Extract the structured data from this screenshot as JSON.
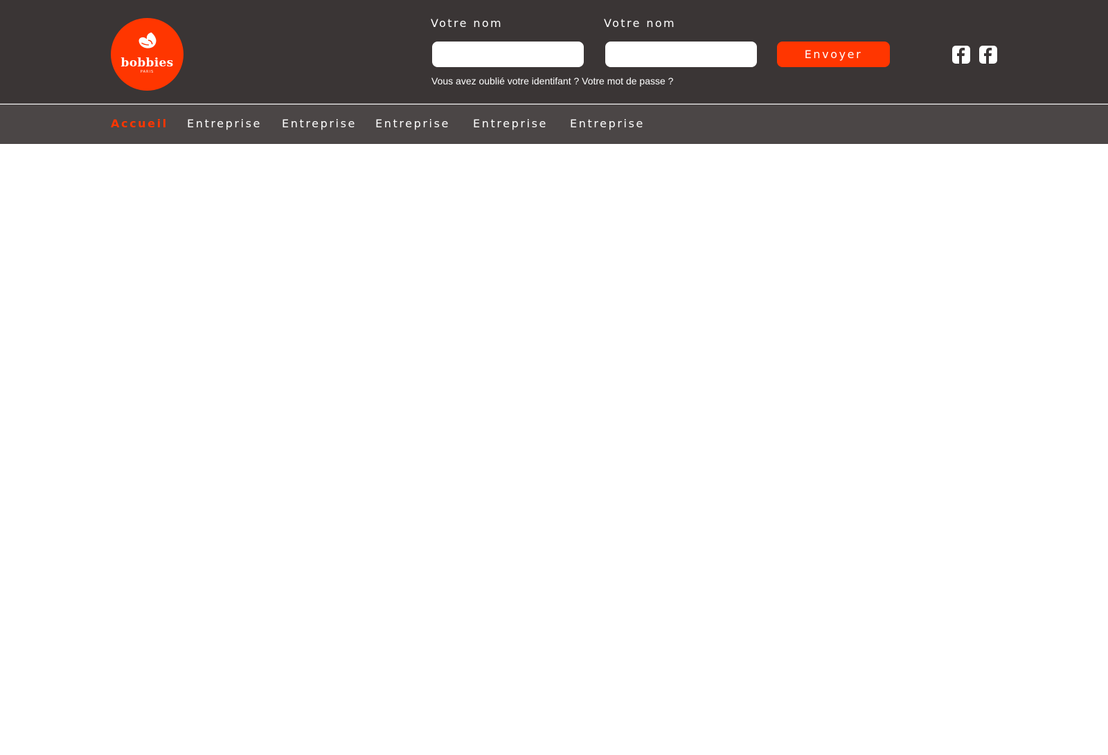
{
  "brand": {
    "name": "bobbies",
    "tagline": "PARIS",
    "accent_color": "#ff3600"
  },
  "login": {
    "field1": {
      "label": "Votre nom",
      "value": "",
      "placeholder": ""
    },
    "field2": {
      "label": "Votre nom",
      "value": "",
      "placeholder": ""
    },
    "submit_label": "Envoyer",
    "forgot_id": "Vous avez oublié votre identifant ?",
    "forgot_password": "Votre mot de passe ?"
  },
  "social": {
    "icons": [
      "facebook-icon",
      "facebook-icon"
    ]
  },
  "nav": {
    "items": [
      {
        "label": "Accueil",
        "active": true
      },
      {
        "label": "Entreprise",
        "active": false
      },
      {
        "label": "Entreprise",
        "active": false
      },
      {
        "label": "Entreprise",
        "active": false
      },
      {
        "label": "Entreprise",
        "active": false
      },
      {
        "label": "Entreprise",
        "active": false
      }
    ]
  }
}
